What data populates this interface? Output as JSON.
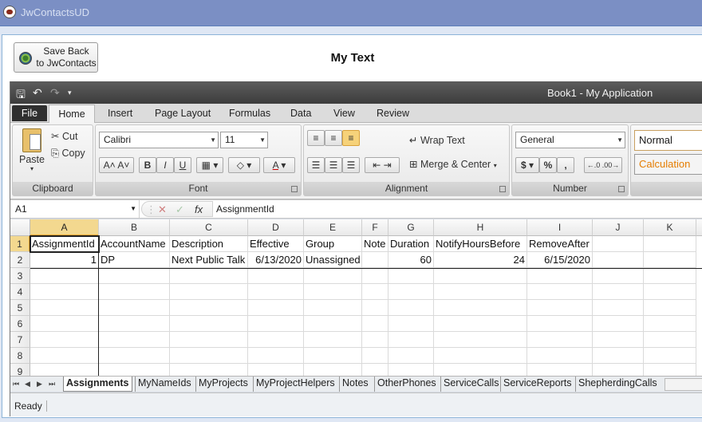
{
  "window": {
    "title": "JwContactsUD"
  },
  "host": {
    "save_button": "Save Back\nto JwContacts",
    "header_text": "My Text"
  },
  "app": {
    "caption": "Book1 - My Application"
  },
  "ribbon_tabs": [
    "File",
    "Home",
    "Insert",
    "Page Layout",
    "Formulas",
    "Data",
    "View",
    "Review"
  ],
  "clipboard": {
    "paste": "Paste",
    "cut": "Cut",
    "copy": "Copy",
    "group": "Clipboard"
  },
  "font": {
    "family": "Calibri",
    "size": "11",
    "group": "Font"
  },
  "alignment": {
    "wrap": "Wrap Text",
    "merge": "Merge & Center",
    "group": "Alignment"
  },
  "number": {
    "format": "General",
    "group": "Number"
  },
  "styles": {
    "normal": "Normal",
    "calculation": "Calculation"
  },
  "formula_bar": {
    "name_box": "A1",
    "fx": "fx",
    "value": "AssignmentId"
  },
  "columns": [
    "A",
    "B",
    "C",
    "D",
    "E",
    "F",
    "G",
    "H",
    "I",
    "J",
    "K"
  ],
  "rows": [
    "1",
    "2",
    "3",
    "4",
    "5",
    "6",
    "7",
    "8",
    "9"
  ],
  "cells": {
    "row1": [
      "AssignmentId",
      "AccountName",
      "Description",
      "Effective",
      "Group",
      "Note",
      "Duration",
      "NotifyHoursBefore",
      "RemoveAfter",
      "",
      ""
    ],
    "row2": [
      "1",
      "DP",
      "Next Public Talk",
      "6/13/2020",
      "Unassigned",
      "",
      "60",
      "24",
      "6/15/2020",
      "",
      ""
    ]
  },
  "sheet_tabs": [
    "Assignments",
    "MyNameIds",
    "MyProjects",
    "MyProjectHelpers",
    "Notes",
    "OtherPhones",
    "ServiceCalls",
    "ServiceReports",
    "ShepherdingCalls"
  ],
  "status": {
    "text": "Ready"
  },
  "colors": {
    "title_bar": "#7b8fc4",
    "selected_header": "#f3d88f",
    "accent": "#e3a32a"
  }
}
